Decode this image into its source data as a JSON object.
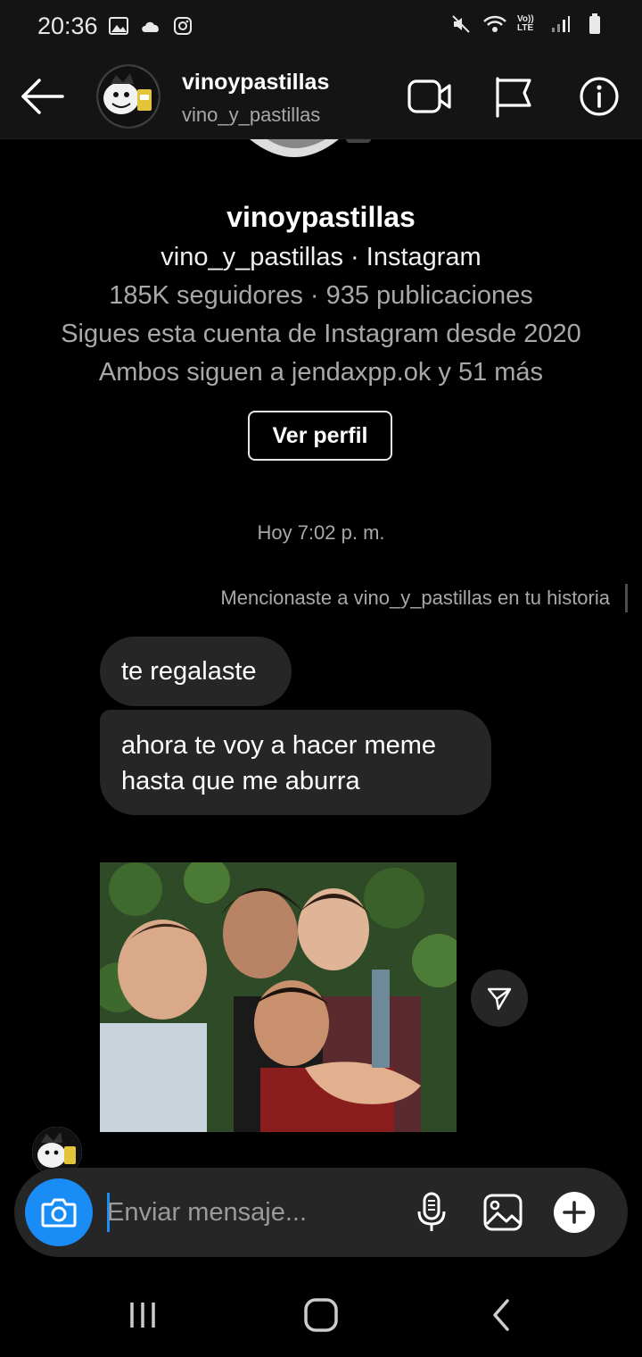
{
  "status_bar": {
    "time": "20:36",
    "left_icons": [
      "gallery-icon",
      "cloud-icon",
      "instagram-icon"
    ],
    "right_icons": [
      "mute-icon",
      "wifi-icon",
      "volte-icon",
      "signal-icon",
      "battery-icon"
    ],
    "volte_label": "Vo)) LTE"
  },
  "header": {
    "name": "vinoypastillas",
    "handle": "vino_y_pastillas",
    "icons": [
      "video-call-icon",
      "flag-icon",
      "info-icon"
    ]
  },
  "profile": {
    "name": "vinoypastillas",
    "handle_line": "vino_y_pastillas · Instagram",
    "stats": "185K seguidores · 935 publicaciones",
    "following_since": "Sigues esta cuenta de Instagram desde 2020",
    "mutual": "Ambos siguen a jendaxpp.ok y 51 más",
    "view_button": "Ver perfil"
  },
  "thread": {
    "timestamp": "Hoy 7:02 p. m.",
    "mention_note": "Mencionaste a vino_y_pastillas en tu historia",
    "messages": [
      {
        "text": "te regalaste"
      },
      {
        "text_lines": [
          "ahora te voy a hacer meme",
          "hasta que me aburra"
        ]
      }
    ]
  },
  "composer": {
    "placeholder": "Enviar mensaje...",
    "value": "",
    "icons": [
      "camera-icon",
      "microphone-icon",
      "gallery-icon",
      "plus-icon"
    ]
  },
  "navbar": {
    "icons": [
      "recent-apps-icon",
      "home-icon",
      "back-icon"
    ]
  },
  "colors": {
    "background": "#000000",
    "bar": "#141414",
    "bubble": "#262626",
    "accent": "#1a8cf5",
    "muted_text": "#a8a8a8"
  }
}
